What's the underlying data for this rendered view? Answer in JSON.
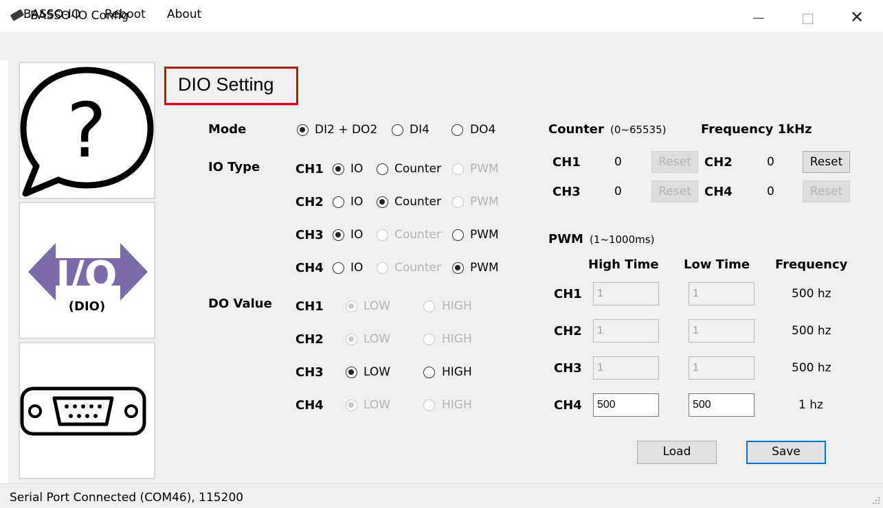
{
  "window": {
    "title": "BASSO-IO Config"
  },
  "menu": [
    "BASSO-IO",
    "Reboot",
    "About"
  ],
  "sidebar": {
    "dio_caption": "(DIO)",
    "io_text": "I/O"
  },
  "panel": {
    "title": "DIO Setting"
  },
  "mode": {
    "label": "Mode",
    "options": [
      {
        "label": "DI2 + DO2",
        "checked": true,
        "enabled": true
      },
      {
        "label": "DI4",
        "checked": false,
        "enabled": true
      },
      {
        "label": "DO4",
        "checked": false,
        "enabled": true
      }
    ]
  },
  "io_type": {
    "label": "IO Type",
    "rows": [
      {
        "ch": "CH1",
        "io": "IO",
        "counter": "Counter",
        "pwm": "PWM",
        "selected": "io"
      },
      {
        "ch": "CH2",
        "io": "IO",
        "counter": "Counter",
        "pwm": "PWM",
        "selected": "counter"
      },
      {
        "ch": "CH3",
        "io": "IO",
        "counter": "Counter",
        "pwm": "PWM",
        "selected": "io"
      },
      {
        "ch": "CH4",
        "io": "IO",
        "counter": "Counter",
        "pwm": "PWM",
        "selected": "pwm"
      }
    ]
  },
  "do_value": {
    "label": "DO Value",
    "rows": [
      {
        "ch": "CH1",
        "low": "LOW",
        "high": "HIGH",
        "selected": "low",
        "enabled": false
      },
      {
        "ch": "CH2",
        "low": "LOW",
        "high": "HIGH",
        "selected": "low",
        "enabled": false
      },
      {
        "ch": "CH3",
        "low": "LOW",
        "high": "HIGH",
        "selected": "low",
        "enabled": true
      },
      {
        "ch": "CH4",
        "low": "LOW",
        "high": "HIGH",
        "selected": "low",
        "enabled": false
      }
    ]
  },
  "counter": {
    "label": "Counter",
    "range": "(0~65535)",
    "frequency": "Frequency 1kHz",
    "channels": [
      {
        "ch": "CH1",
        "value": "0",
        "reset": "Reset",
        "reset_enabled": false
      },
      {
        "ch": "CH2",
        "value": "0",
        "reset": "Reset",
        "reset_enabled": true
      },
      {
        "ch": "CH3",
        "value": "0",
        "reset": "Reset",
        "reset_enabled": false
      },
      {
        "ch": "CH4",
        "value": "0",
        "reset": "Reset",
        "reset_enabled": false
      }
    ]
  },
  "pwm": {
    "label": "PWM",
    "range": "(1~1000ms)",
    "headers": {
      "high": "High Time",
      "low": "Low Time",
      "freq": "Frequency"
    },
    "rows": [
      {
        "ch": "CH1",
        "high": "1",
        "low": "1",
        "freq": "500 hz",
        "enabled": false
      },
      {
        "ch": "CH2",
        "high": "1",
        "low": "1",
        "freq": "500 hz",
        "enabled": false
      },
      {
        "ch": "CH3",
        "high": "1",
        "low": "1",
        "freq": "500 hz",
        "enabled": false
      },
      {
        "ch": "CH4",
        "high": "500",
        "low": "500",
        "freq": "1 hz",
        "enabled": true
      }
    ]
  },
  "actions": {
    "load": "Load",
    "save": "Save"
  },
  "status": {
    "text": "Serial Port Connected (COM46), 115200"
  },
  "colors": {
    "title_box": "#e00000",
    "dio_icon": "#7c6ba8",
    "default_button_border": "#0078d7"
  }
}
